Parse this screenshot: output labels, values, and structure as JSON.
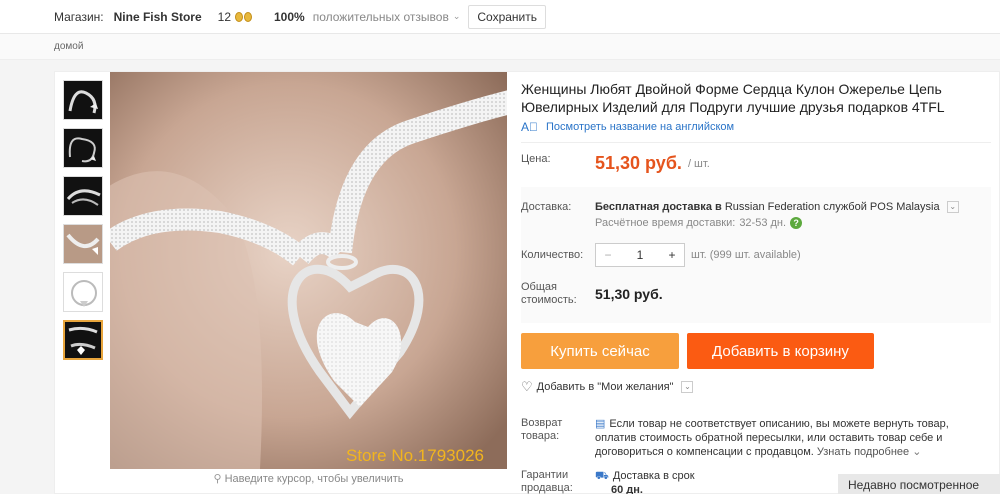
{
  "store": {
    "label": "Магазин:",
    "name": "Nine Fish Store",
    "rating": "12",
    "positive_pct": "100%",
    "feedback_label": "положительных отзывов",
    "save_label": "Сохранить"
  },
  "breadcrumb": {
    "home": "домой"
  },
  "gallery": {
    "hint": "Наведите курсор, чтобы увеличить",
    "watermark": "Store No.1793026"
  },
  "product": {
    "title": "Женщины Любят Двойной Форме Сердца Кулон Ожерелье Цепь Ювелирных Изделий для Подруги лучшие друзья подарков 4TFL",
    "en_link": "Посмотреть название на английском"
  },
  "price": {
    "label": "Цена:",
    "value": "51,30 руб.",
    "unit": "/ шт."
  },
  "shipping": {
    "label": "Доставка:",
    "free": "Бесплатная доставка",
    "to_prefix": "в",
    "country": "Russian Federation",
    "carrier": "службой POS Malaysia",
    "time_label": "Расчётное время доставки:",
    "time_value": "32-53 дн."
  },
  "quantity": {
    "label": "Количество:",
    "value": "1",
    "available": "шт. (999 шт. available)"
  },
  "total": {
    "label": "Общая стоимость:",
    "value": "51,30 руб."
  },
  "buttons": {
    "buy": "Купить сейчас",
    "cart": "Добавить в корзину"
  },
  "wishlist": {
    "label": "Добавить в \"Мои желания\""
  },
  "returns": {
    "label": "Возврат товара:",
    "text": "Если товар не соответствует описанию, вы можете вернуть товар, оплатив стоимость обратной пересылки, или оставить товар себе и договориться о компенсации с продавцом.",
    "more": "Узнать подробнее"
  },
  "warranty": {
    "label": "Гарантии продавца:",
    "line1": "Доставка в срок",
    "line2": "60 дн."
  },
  "recent": "Недавно посмотренное",
  "colors": {
    "price": "#e5541d",
    "buy": "#f79f3d",
    "cart": "#fb5b12",
    "link": "#2a74c8"
  }
}
